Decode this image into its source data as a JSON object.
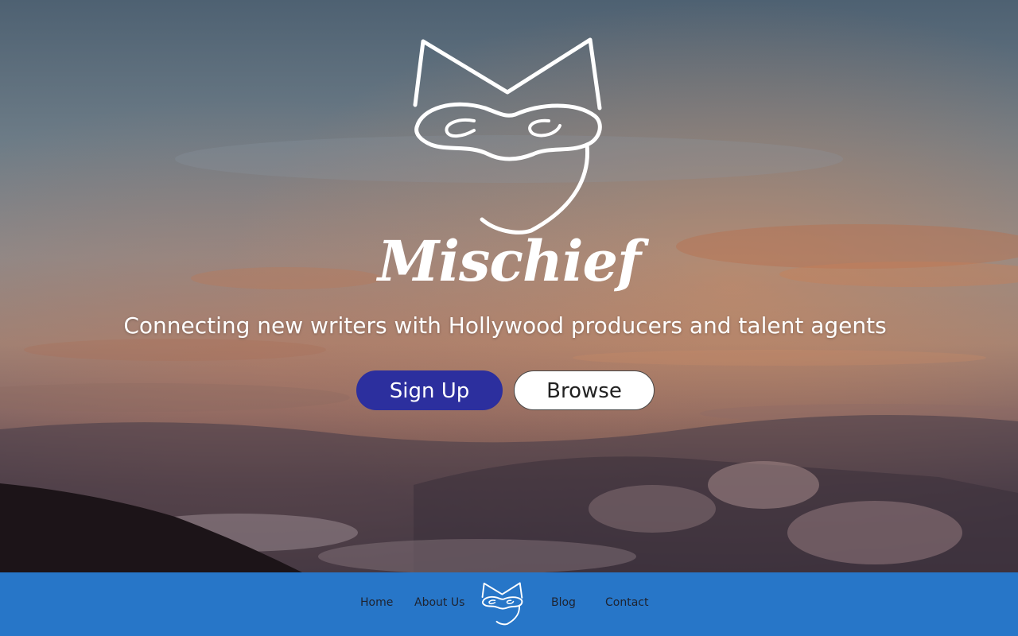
{
  "hero": {
    "brand_name": "Mischief",
    "tagline": "Connecting new writers with Hollywood producers and talent agents",
    "background": "sunset-clouds-mountain-photo",
    "logo_icon": "cat-mask-icon"
  },
  "cta": {
    "signup_label": "Sign Up",
    "browse_label": "Browse"
  },
  "footer": {
    "nav": {
      "home": "Home",
      "about": "About Us",
      "blog": "Blog",
      "contact": "Contact"
    },
    "logo_icon": "cat-mask-icon"
  },
  "colors": {
    "signup_button": "#2c2f9e",
    "browse_button": "#ffffff",
    "footer_bar": "#2776c8",
    "nav_text": "#1e2330"
  }
}
